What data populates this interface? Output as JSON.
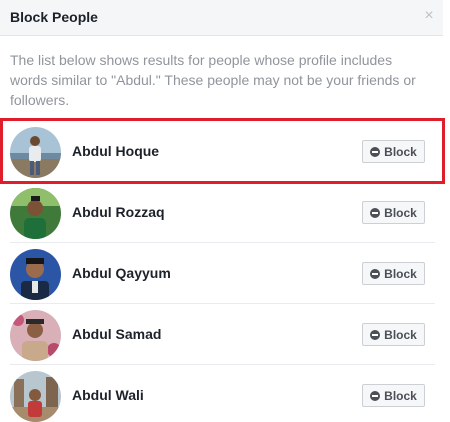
{
  "dialog": {
    "title": "Block People",
    "close_symbol": "×",
    "description": "The list below shows results for people whose profile includes words similar to \"Abdul.\" These people may not be your friends or followers."
  },
  "people": [
    {
      "name": "Abdul Hoque",
      "button": "Block",
      "avatar": "photo-man-standing"
    },
    {
      "name": "Abdul Rozzaq",
      "button": "Block",
      "avatar": "photo-young-man-green"
    },
    {
      "name": "Abdul Qayyum",
      "button": "Block",
      "avatar": "photo-man-blue-bg"
    },
    {
      "name": "Abdul Samad",
      "button": "Block",
      "avatar": "photo-man-pink-flowers"
    },
    {
      "name": "Abdul Wali",
      "button": "Block",
      "avatar": "photo-man-ruins"
    }
  ],
  "colors": {
    "highlight": "#e01e2b",
    "header_bg": "#f5f6f7",
    "description_text": "#90949c"
  },
  "icons": [
    "close-icon",
    "block-minus-icon"
  ]
}
